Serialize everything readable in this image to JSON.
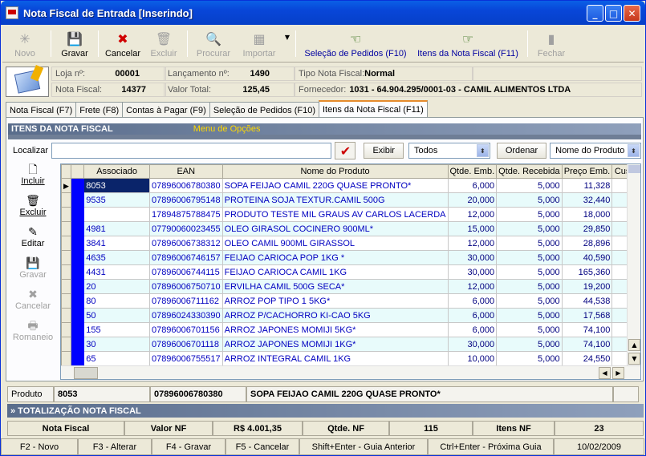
{
  "window": {
    "title": "Nota Fiscal de Entrada [Inserindo]"
  },
  "toolbar": {
    "novo": "Novo",
    "gravar": "Gravar",
    "cancelar": "Cancelar",
    "excluir": "Excluir",
    "procurar": "Procurar",
    "importar": "Importar",
    "selecao_pedidos": "Seleção de Pedidos (F10)",
    "itens_nota": "Itens da Nota Fiscal (F11)",
    "fechar": "Fechar"
  },
  "header": {
    "loja_label": "Loja nº:",
    "loja_value": "00001",
    "lancamento_label": "Lançamento nº:",
    "lancamento_value": "1490",
    "tipo_label": "Tipo Nota Fiscal:",
    "tipo_value": "Normal",
    "nota_label": "Nota Fiscal:",
    "nota_value": "14377",
    "valor_label": "Valor Total:",
    "valor_value": "125,45",
    "fornecedor_label": "Fornecedor:",
    "fornecedor_value": "1031 - 64.904.295/0001-03 - CAMIL ALIMENTOS LTDA"
  },
  "tabs": [
    "Nota Fiscal (F7)",
    "Frete (F8)",
    "Contas à Pagar (F9)",
    "Seleção de Pedidos (F10)",
    "Itens da Nota Fiscal (F11)"
  ],
  "panel": {
    "section_title": "ITENS DA NOTA FISCAL",
    "menu_label": "Menu de Opções",
    "localizar_label": "Localizar",
    "exibir_label": "Exibir",
    "exibir_value": "Todos",
    "ordenar_label": "Ordenar",
    "ordenar_value": "Nome do Produto"
  },
  "actions": {
    "incluir": "Incluir",
    "excluir": "Excluir",
    "editar": "Editar",
    "gravar": "Gravar",
    "cancelar": "Cancelar",
    "romaneio": "Romaneio"
  },
  "grid": {
    "columns": [
      "Associado",
      "EAN",
      "Nome do Produto",
      "Qtde. Emb.",
      "Qtde. Recebida",
      "Preço Emb.",
      "Custo"
    ],
    "rows": [
      [
        "8053",
        "07896006780380",
        "SOPA FEIJAO CAMIL 220G QUASE PRONTO*",
        "6,000",
        "5,000",
        "11,328"
      ],
      [
        "9535",
        "07896006795148",
        "PROTEINA SOJA TEXTUR.CAMIL 500G",
        "20,000",
        "5,000",
        "32,440"
      ],
      [
        "",
        "17894875788475",
        "PRODUTO TESTE MIL GRAUS AV CARLOS LACERDA",
        "12,000",
        "5,000",
        "18,000"
      ],
      [
        "4981",
        "07790060023455",
        "OLEO GIRASOL COCINERO 900ML*",
        "15,000",
        "5,000",
        "29,850"
      ],
      [
        "3841",
        "07896006738312",
        "OLEO CAMIL 900ML GIRASSOL",
        "12,000",
        "5,000",
        "28,896"
      ],
      [
        "4635",
        "07896006746157",
        "FEIJAO CARIOCA POP 1KG *",
        "30,000",
        "5,000",
        "40,590"
      ],
      [
        "4431",
        "07896006744115",
        "FEIJAO CARIOCA CAMIL 1KG",
        "30,000",
        "5,000",
        "165,360"
      ],
      [
        "20",
        "07896006750710",
        "ERVILHA CAMIL 500G SECA*",
        "12,000",
        "5,000",
        "19,200"
      ],
      [
        "80",
        "07896006711162",
        "ARROZ POP TIPO 1 5KG*",
        "6,000",
        "5,000",
        "44,538"
      ],
      [
        "50",
        "07896024330390",
        "ARROZ P/CACHORRO KI-CAO 5KG",
        "6,000",
        "5,000",
        "17,568"
      ],
      [
        "155",
        "07896006701156",
        "ARROZ JAPONES MOMIJI 5KG*",
        "6,000",
        "5,000",
        "74,100"
      ],
      [
        "30",
        "07896006701118",
        "ARROZ JAPONES MOMIJI 1KG*",
        "30,000",
        "5,000",
        "74,100"
      ],
      [
        "65",
        "07896006755517",
        "ARROZ INTEGRAL CAMIL 1KG",
        "10,000",
        "5,000",
        "24,550"
      ]
    ]
  },
  "product": {
    "label": "Produto",
    "code": "8053",
    "ean": "07896006780380",
    "name": "SOPA FEIJAO CAMIL 220G QUASE PRONTO*"
  },
  "totals": {
    "title": "» TOTALIZAÇÃO NOTA FISCAL",
    "nota_label": "Nota Fiscal",
    "valor_label": "Valor NF",
    "valor_value": "R$ 4.001,35",
    "qtde_label": "Qtde. NF",
    "qtde_value": "115",
    "itens_label": "Itens NF",
    "itens_value": "23"
  },
  "status": [
    "F2 - Novo",
    "F3 - Alterar",
    "F4 - Gravar",
    "F5 - Cancelar",
    "Shift+Enter - Guia Anterior",
    "Ctrl+Enter - Próxima Guia",
    "10/02/2009"
  ]
}
